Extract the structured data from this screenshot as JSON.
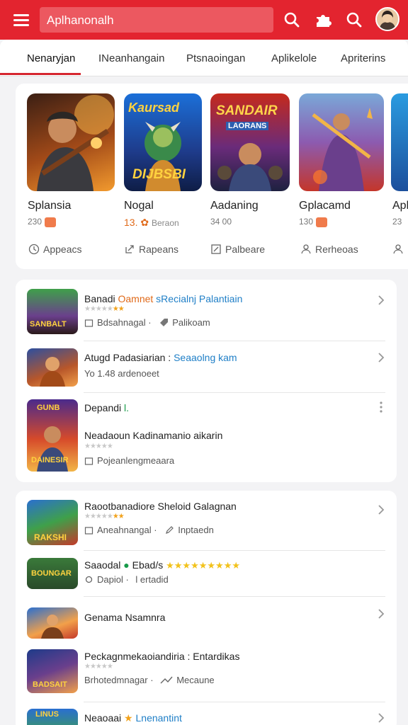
{
  "colors": {
    "brand": "#e3242f",
    "accent_blue": "#1f7fc7",
    "star": "#f2a21b"
  },
  "header": {
    "menu_icon": "hamburger-menu-icon",
    "search_value": "Aplhanonalh",
    "icons": [
      "search-icon",
      "puzzle-icon",
      "search-icon",
      "avatar"
    ]
  },
  "tabs": [
    {
      "label": "Nenaryjan",
      "active": true
    },
    {
      "label": "INeanhangain"
    },
    {
      "label": "Ptsnaoingan"
    },
    {
      "label": "Aplikelole"
    },
    {
      "label": "Apriterins"
    }
  ],
  "carousel": [
    {
      "title": "Splansia",
      "meta": "230",
      "action": "Appeacs",
      "action_icon": "clock-icon",
      "art_text": ""
    },
    {
      "title": "Nogal",
      "meta": "13.",
      "meta_extra": "Beraon",
      "action": "Rapeans",
      "action_icon": "external-link-icon",
      "art_text_top": "Kaursad",
      "art_text_bottom": "DIJBSBI"
    },
    {
      "title": "Aadaning",
      "meta": "34 00",
      "action": "Palbeare",
      "action_icon": "edit-icon",
      "art_text_top": "SANDAIR",
      "art_text_bottom": "LAORANS"
    },
    {
      "title": "Gplacamd",
      "meta": "130",
      "action": "Rerheoas",
      "action_icon": "users-icon",
      "art_text": ""
    },
    {
      "title": "Apl",
      "meta": "23",
      "action": "",
      "action_icon": "users-icon",
      "art_text": ""
    }
  ],
  "list1": [
    {
      "title_a": "Banadi ",
      "title_b": "Oamnet",
      "title_c": " sRecialnj Palantiain",
      "stars": "★★★★★",
      "gold": "★★",
      "sub_a": "Bdsahnagal ·",
      "sub_b": "Palikoam",
      "thumb_text": "SANBALT"
    },
    {
      "title_a": "Atugd Padasiarian : ",
      "title_b": "Seaaolng kam",
      "sub_a": "Yo 1.48 ardenoeet",
      "thumb_text": ""
    },
    {
      "title_a": "Depandi ",
      "title_b": "l.",
      "title2": "Neadaoun Kadinamanio aikarin",
      "stars": "★★★★★",
      "sub_a": "Pojeanlengmeaara",
      "thumb_text_top": "GUNB",
      "thumb_text_bottom": "DAINESIR"
    }
  ],
  "list2": [
    {
      "title_a": "Raootbanadiore Sheloid Galagnan",
      "stars": "★★★★★",
      "gold": "★★",
      "sub_a": "Aneahnangal ·",
      "sub_b": "Inptaedn",
      "thumb_text": "RAKSHI"
    },
    {
      "title_a": "Saaodal ",
      "title_b": "Ebad/s",
      "stars_inline": "★★★★★★★★★",
      "sub_a": "Dapiol ·",
      "sub_b": "l ertadid",
      "thumb_text": "BOUNGAR"
    },
    {
      "title_a": "Genama Nsamnra",
      "thumb_text": ""
    },
    {
      "title_a": "Peckagnmekaoiandiria : Entardikas",
      "stars": "★★★★★",
      "sub_a": "Brhotedmnagar ·",
      "sub_b": "Mecaune",
      "thumb_text": "BADSAIT"
    },
    {
      "title_a": "Neaoaai ",
      "title_b": "Lnenantint",
      "thumb_text": "LINUS"
    }
  ]
}
